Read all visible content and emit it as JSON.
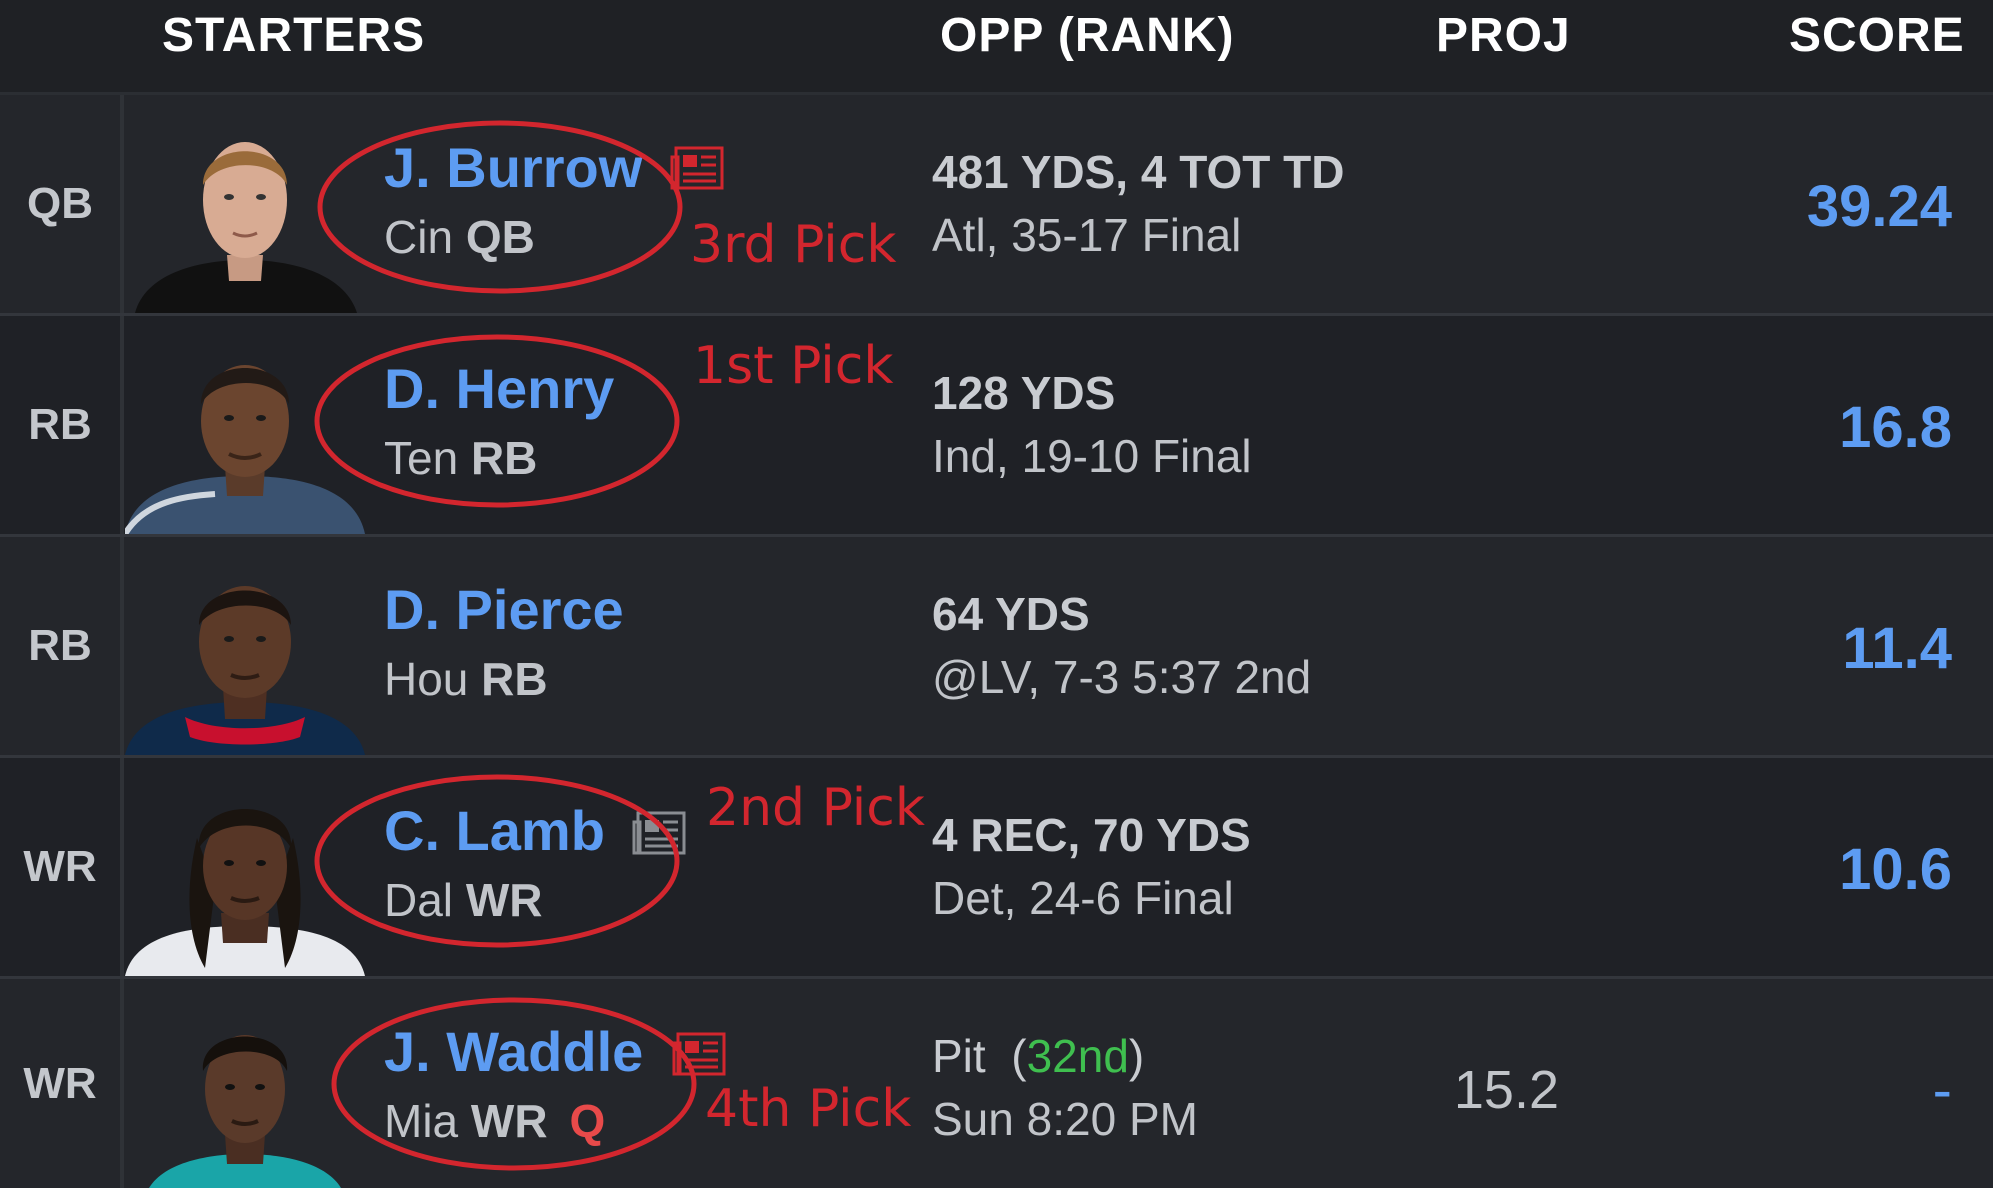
{
  "header": {
    "starters": "STARTERS",
    "opp_rank": "OPP (RANK)",
    "proj": "PROJ",
    "score": "SCORE"
  },
  "rows": [
    {
      "pos": "QB",
      "name": "J. Burrow",
      "team": "Cin",
      "team_pos": "QB",
      "status": "",
      "opp_line1": "481 YDS, 4 TOT TD",
      "opp_line2": "Atl, 35-17 Final",
      "proj": "",
      "score": "39.24",
      "news_icon": "news-icon",
      "pick": "3rd Pick"
    },
    {
      "pos": "RB",
      "name": "D. Henry",
      "team": "Ten",
      "team_pos": "RB",
      "status": "",
      "opp_line1": "128 YDS",
      "opp_line2": "Ind, 19-10 Final",
      "proj": "",
      "score": "16.8",
      "news_icon": "",
      "pick": "1st Pick"
    },
    {
      "pos": "RB",
      "name": "D. Pierce",
      "team": "Hou",
      "team_pos": "RB",
      "status": "",
      "opp_line1": "64 YDS",
      "opp_line2": "@LV, 7-3 5:37 2nd",
      "proj": "",
      "score": "11.4",
      "news_icon": "",
      "pick": ""
    },
    {
      "pos": "WR",
      "name": "C. Lamb",
      "team": "Dal",
      "team_pos": "WR",
      "status": "",
      "opp_line1": "4 REC, 70 YDS",
      "opp_line2": "Det, 24-6 Final",
      "proj": "",
      "score": "10.6",
      "news_icon": "news-icon",
      "pick": "2nd Pick"
    },
    {
      "pos": "WR",
      "name": "J. Waddle",
      "team": "Mia",
      "team_pos": "WR",
      "status": "Q",
      "opp_team": "Pit",
      "opp_rank": "32nd",
      "opp_line2": "Sun 8:20 PM",
      "proj": "15.2",
      "score": "-",
      "news_icon": "news-icon",
      "pick": "4th Pick"
    }
  ],
  "colors": {
    "accent": "#5d9cf2",
    "annotation": "#d3262e",
    "rank_good": "#3fbf4f",
    "injury": "#e84a4a"
  }
}
